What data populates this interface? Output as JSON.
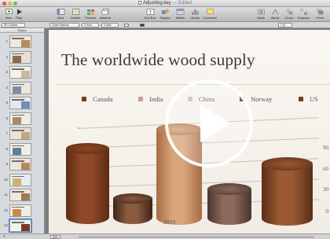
{
  "window": {
    "title": "Adjusting.key",
    "separator": "—",
    "status": "Edited",
    "traffic_lights": [
      "#e4574e",
      "#e7b93a",
      "#62c653"
    ]
  },
  "toolbar": {
    "items": [
      {
        "label": "New",
        "icon": "new-slide-icon"
      },
      {
        "label": "Play",
        "icon": "play-icon"
      },
      {
        "label": "View",
        "icon": "view-icon"
      },
      {
        "label": "Guides",
        "icon": "guides-icon"
      },
      {
        "label": "Themes",
        "icon": "themes-icon"
      },
      {
        "label": "Masters",
        "icon": "masters-icon"
      },
      {
        "label": "Text Box",
        "icon": "text-box-icon"
      },
      {
        "label": "Shapes",
        "icon": "shapes-icon"
      },
      {
        "label": "Tables",
        "icon": "tables-icon"
      },
      {
        "label": "Charts",
        "icon": "charts-icon"
      },
      {
        "label": "Comment",
        "icon": "comment-icon"
      },
      {
        "label": "Mask",
        "icon": "mask-icon"
      },
      {
        "label": "Alpha",
        "icon": "alpha-icon"
      },
      {
        "label": "Group",
        "icon": "group-icon"
      },
      {
        "label": "Ungroup",
        "icon": "ungroup-icon"
      },
      {
        "label": "Front",
        "icon": "front-icon"
      }
    ]
  },
  "format_bar": {
    "columns": "3D Column",
    "chart_options": "Chart Options",
    "axis1": "X Axis",
    "axis2": "Y Axis",
    "line_width": "1 pt"
  },
  "navigator": {
    "header": "Slides",
    "slide_numbers": [
      "1",
      "2",
      "3",
      "4",
      "5",
      "6",
      "7",
      "8",
      "9",
      "10",
      "11",
      "12",
      "13"
    ],
    "selected": 13
  },
  "slide": {
    "title": "The worldwide wood supply"
  },
  "chart_data": {
    "type": "bar",
    "categories": [
      "2010"
    ],
    "series": [
      {
        "name": "Canada",
        "values": [
          74
        ],
        "color": "#7a3a1f"
      },
      {
        "name": "India",
        "values": [
          22
        ],
        "color": "#c7a08d"
      },
      {
        "name": "China",
        "values": [
          95
        ],
        "color": "#d9b8a8"
      },
      {
        "name": "Norway",
        "values": [
          32
        ],
        "color": "#4a3130"
      },
      {
        "name": "US",
        "values": [
          58
        ],
        "color": "#7b3b22"
      }
    ],
    "y_ticks": [
      "90",
      "60",
      "30",
      "0"
    ],
    "xlabel": "2010",
    "legend_position": "top"
  },
  "bottom_bar": {
    "zoom": "89%",
    "add_symbol": "+"
  },
  "overlay": {
    "play_icon": "play-icon"
  }
}
